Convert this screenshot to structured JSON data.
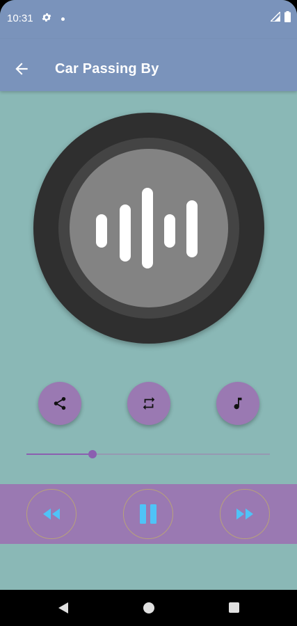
{
  "status_bar": {
    "time": "10:31",
    "icons": [
      "gear-icon",
      "dot-icon",
      "signal-icon",
      "battery-icon"
    ]
  },
  "app_bar": {
    "title": "Car Passing By",
    "back_icon": "arrow-left-icon"
  },
  "artwork": {
    "icon": "waveform-icon"
  },
  "actions": [
    {
      "name": "share",
      "icon": "share-icon"
    },
    {
      "name": "repeat",
      "icon": "repeat-icon"
    },
    {
      "name": "music",
      "icon": "music-note-icon"
    }
  ],
  "seek": {
    "progress": 0.27
  },
  "controls": [
    {
      "name": "rewind",
      "icon": "rewind-icon"
    },
    {
      "name": "pause",
      "icon": "pause-icon"
    },
    {
      "name": "fast-forward",
      "icon": "fast-forward-icon"
    }
  ],
  "colors": {
    "app_bar": "#7a93bb",
    "background": "#8ab8b6",
    "accent_purple": "#9a79b2",
    "control_icon": "#4fc3f7",
    "disc_dark": "#2f2f2f",
    "disc_inner": "#838383"
  }
}
